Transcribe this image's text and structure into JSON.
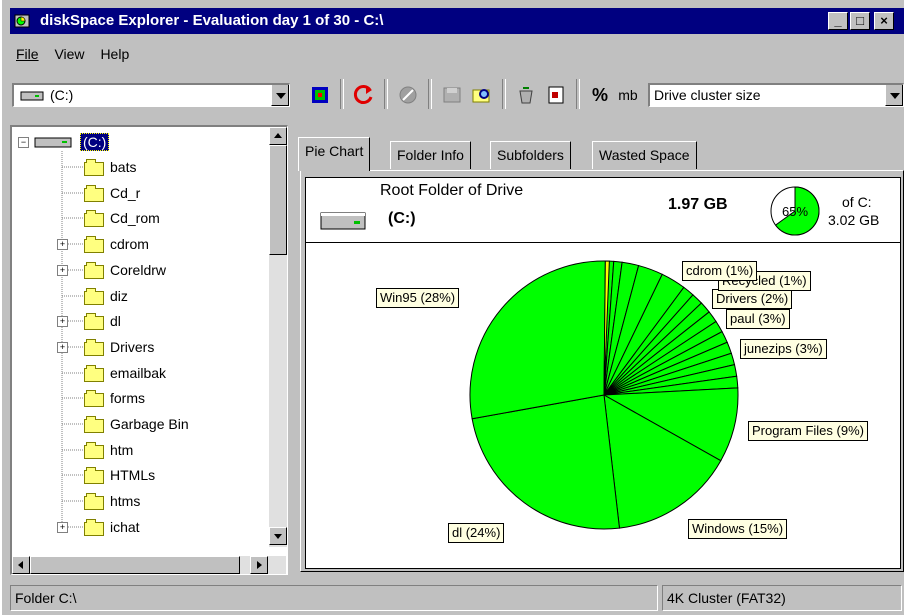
{
  "window": {
    "title": "diskSpace Explorer - Evaluation day 1 of 30 - C:\\",
    "minimize_glyph": "_",
    "maximize_glyph": "□",
    "close_glyph": "×"
  },
  "menu": [
    {
      "label": "File",
      "accel": "F"
    },
    {
      "label": "View",
      "accel": "V"
    },
    {
      "label": "Help",
      "accel": "H"
    }
  ],
  "toolbar": {
    "drive_combo_value": "(C:)",
    "percent_label": "%",
    "mb_label": "mb",
    "size_mode_value": "Drive cluster size",
    "icons": [
      "drive-map-icon",
      "refresh-icon",
      "disabled-stop-icon",
      "save-icon",
      "find-icon",
      "recycle-bin-icon",
      "properties-icon"
    ]
  },
  "tree": {
    "root_label": "(C:)",
    "items": [
      {
        "label": "bats",
        "expandable": false
      },
      {
        "label": "Cd_r",
        "expandable": false
      },
      {
        "label": "Cd_rom",
        "expandable": false
      },
      {
        "label": "cdrom",
        "expandable": true
      },
      {
        "label": "Coreldrw",
        "expandable": true
      },
      {
        "label": "diz",
        "expandable": false
      },
      {
        "label": "dl",
        "expandable": true
      },
      {
        "label": "Drivers",
        "expandable": true
      },
      {
        "label": "emailbak",
        "expandable": false
      },
      {
        "label": "forms",
        "expandable": false
      },
      {
        "label": "Garbage Bin",
        "expandable": false
      },
      {
        "label": "htm",
        "expandable": false
      },
      {
        "label": "HTMLs",
        "expandable": false
      },
      {
        "label": "htms",
        "expandable": false
      },
      {
        "label": "ichat",
        "expandable": true
      }
    ]
  },
  "tabs": [
    "Pie Chart",
    "Folder Info",
    "Subfolders",
    "Wasted Space"
  ],
  "active_tab": "Pie Chart",
  "info": {
    "title": "Root Folder of Drive",
    "drive": "(C:)",
    "size": "1.97 GB",
    "gauge_percent_label": "65%",
    "gauge_fraction": 0.65,
    "of_drive_label": "of C:",
    "drive_total": "3.02 GB"
  },
  "chart_data": {
    "type": "pie",
    "slices": [
      {
        "label": "Win95 (28%)",
        "value": 28
      },
      {
        "label": "dl (24%)",
        "value": 24
      },
      {
        "label": "Windows (15%)",
        "value": 15
      },
      {
        "label": "Program Files (9%)",
        "value": 9
      },
      {
        "label": "junezips (3%)",
        "value": 3
      },
      {
        "label": "paul (3%)",
        "value": 3
      },
      {
        "label": "Drivers (2%)",
        "value": 2
      },
      {
        "label": "Recycled (1%)",
        "value": 1
      },
      {
        "label": "cdrom (1%)",
        "value": 1
      }
    ],
    "colors": {
      "slice": "#00ff00",
      "edge": "#000000",
      "highlight": "#ffff00"
    }
  },
  "status": {
    "left": "Folder C:\\",
    "right": "4K Cluster (FAT32)"
  }
}
